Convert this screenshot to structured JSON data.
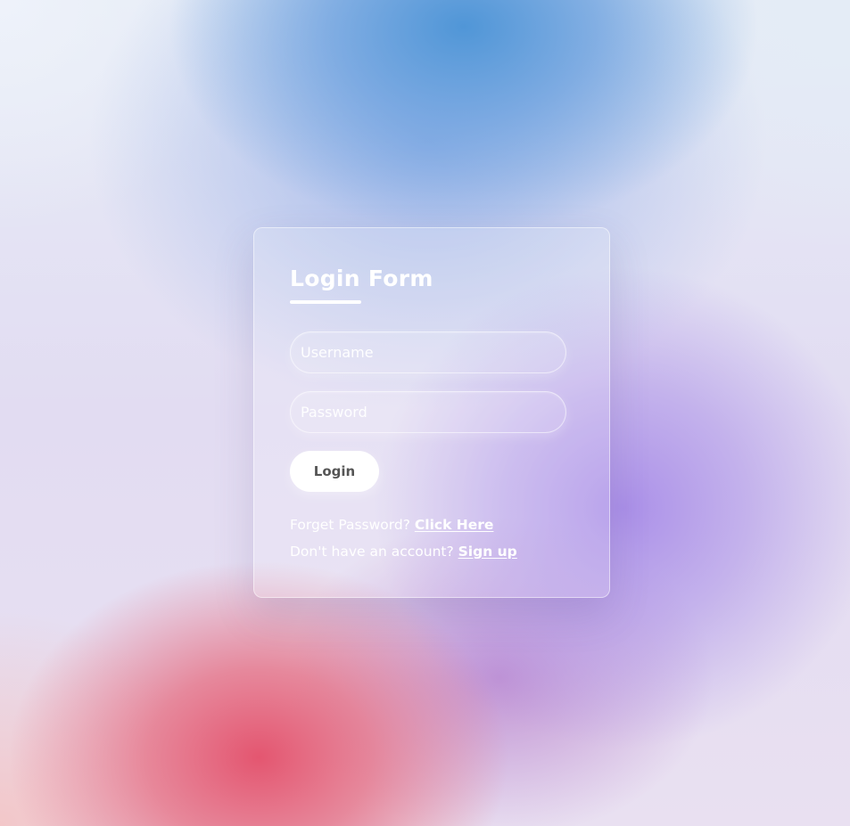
{
  "form": {
    "title": "Login Form",
    "username_placeholder": "Username",
    "password_placeholder": "Password",
    "login_label": "Login",
    "forgot_text": "Forget Password?",
    "forgot_link": "Click Here",
    "signup_text": "Don't have an account?",
    "signup_link": "Sign up"
  },
  "colors": {
    "text": "#ffffff",
    "button_bg": "#ffffff",
    "button_text": "#555555"
  }
}
